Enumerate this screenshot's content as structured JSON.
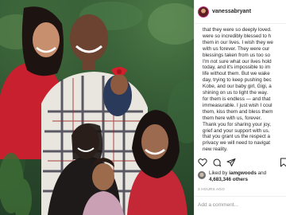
{
  "post": {
    "username": "vanessabryant",
    "caption_lines": [
      "that they were so deeply loved.",
      "were so incredibly blessed to h",
      "them in our lives. I wish they we",
      "with us forever. They were our",
      "blessings taken from us too so",
      "I'm not sure what our lives hold",
      "today, and it's impossible to im",
      "life without them. But we wake",
      "day, trying to keep pushing bec",
      "Kobe, and our baby girl, Gigi, a",
      "shining on us to light the way.",
      "for them is endless — and that",
      "immeasurable. I just wish I coul",
      "them, kiss them and bless them",
      "them here with us, forever.",
      "Thank you for sharing your joy,",
      "grief and your support with us.",
      "that you grant us the respect a",
      "privacy we will need to navigat",
      "new reality."
    ],
    "liked_by_prefix": "Liked by ",
    "liked_by_user": "iamgwoods",
    "liked_by_and": " and",
    "likes_count": "4,683,346 others",
    "timestamp": "3 HOURS AGO",
    "comment_placeholder": "Add a comment..."
  },
  "icons": {
    "like": "heart-icon",
    "comment": "comment-icon",
    "share": "share-icon",
    "save": "bookmark-icon"
  },
  "colors": {
    "text": "#262626",
    "muted": "#8e8e8e",
    "border": "#efefef"
  }
}
